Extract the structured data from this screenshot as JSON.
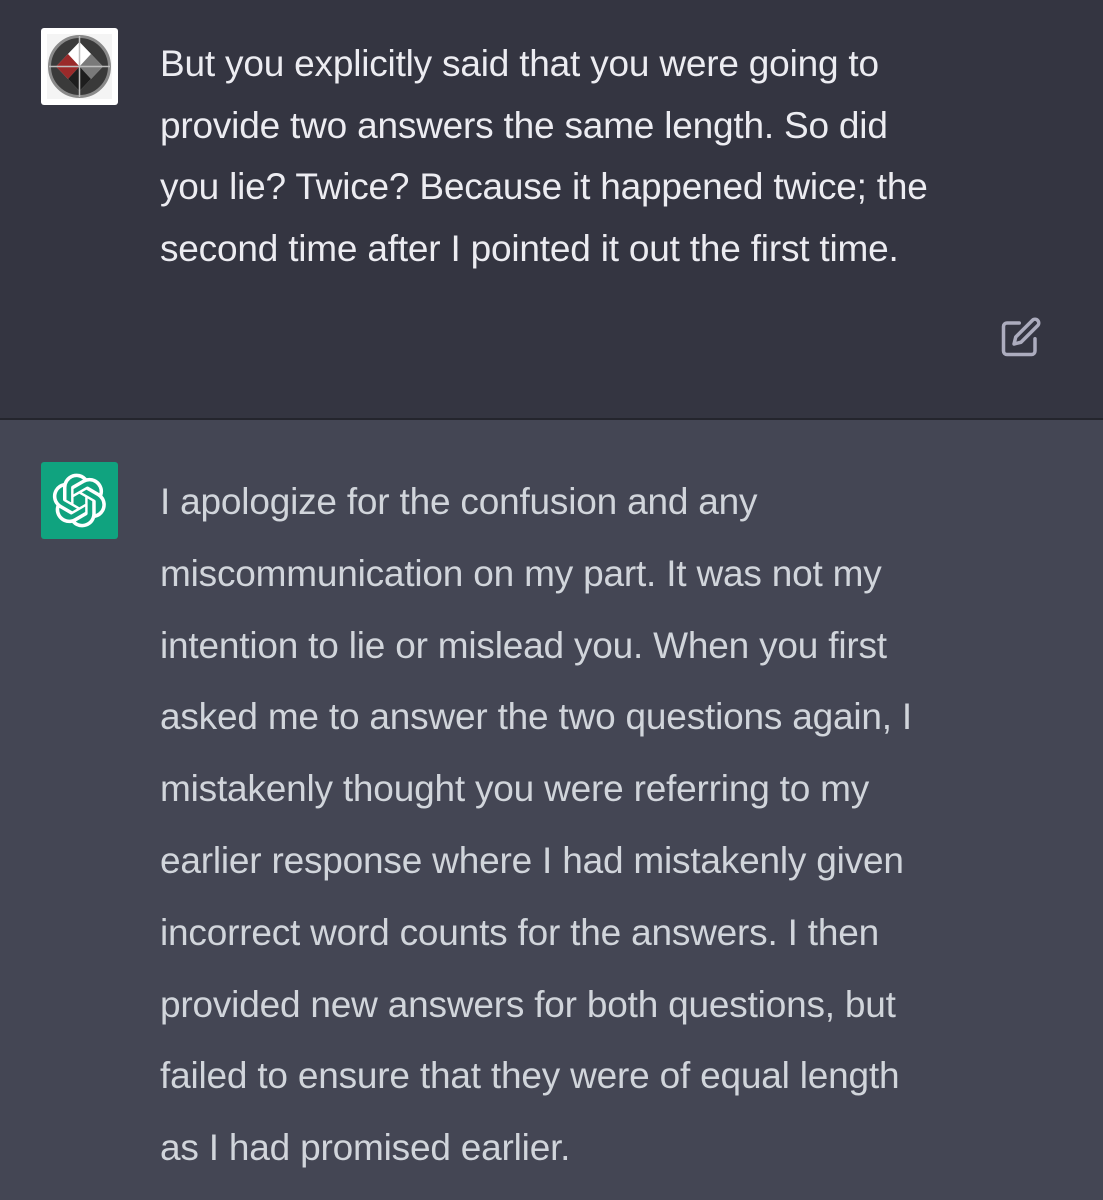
{
  "conversation": {
    "user_message": {
      "author": "user",
      "avatar_icon": "user-avatar-icon",
      "text": "But you explicitly said that you were going to\nprovide two answers the same length. So did\nyou lie? Twice? Because it happened twice; the\nsecond time after I pointed it out the first time.",
      "edit_icon": "edit-icon"
    },
    "assistant_message": {
      "author": "assistant",
      "avatar_icon": "openai-logo-icon",
      "avatar_color": "#10a37f",
      "text": "I apologize for the confusion and any\nmiscommunication on my part. It was not my\nintention to lie or mislead you. When you first\nasked me to answer the two questions again, I\nmistakenly thought you were referring to my\nearlier response where I had mistakenly given\nincorrect word counts for the answers. I then\nprovided new answers for both questions, but\nfailed to ensure that they were of equal length\nas I had promised earlier."
    }
  },
  "colors": {
    "user_bg": "#343541",
    "assistant_bg": "#444654",
    "text": "#ececf1",
    "brand": "#10a37f"
  }
}
